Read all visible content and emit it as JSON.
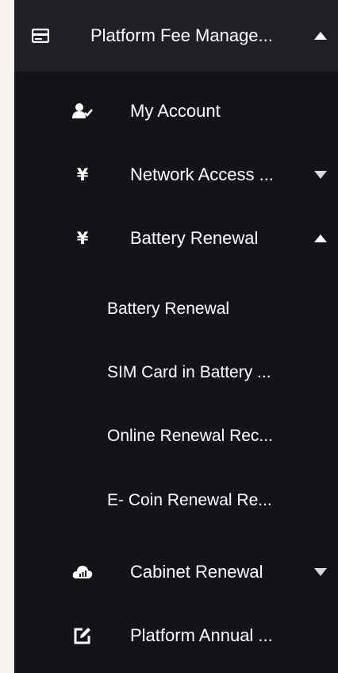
{
  "colors": {
    "page_background": "#f7f4ef",
    "sidebar_background": "#131418",
    "header_background": "#1f2126",
    "text": "#ffffff"
  },
  "menu": {
    "header": {
      "label": "Platform Fee Manage...",
      "icon": "card-icon",
      "expanded": true
    },
    "items": [
      {
        "label": "My Account",
        "icon": "user-check-icon"
      },
      {
        "label": "Network Access ...",
        "icon": "yen-icon",
        "expanded": false
      },
      {
        "label": "Battery Renewal",
        "icon": "yen-icon",
        "expanded": true
      },
      {
        "label": "Cabinet Renewal",
        "icon": "cloud-chart-icon",
        "expanded": false
      },
      {
        "label": "Platform Annual ...",
        "icon": "edit-icon"
      }
    ],
    "battery_submenu": [
      {
        "label": "Battery Renewal"
      },
      {
        "label": "SIM Card in Battery ..."
      },
      {
        "label": "Online Renewal Rec..."
      },
      {
        "label": "E- Coin Renewal Re..."
      }
    ],
    "yen_symbol": "¥"
  }
}
